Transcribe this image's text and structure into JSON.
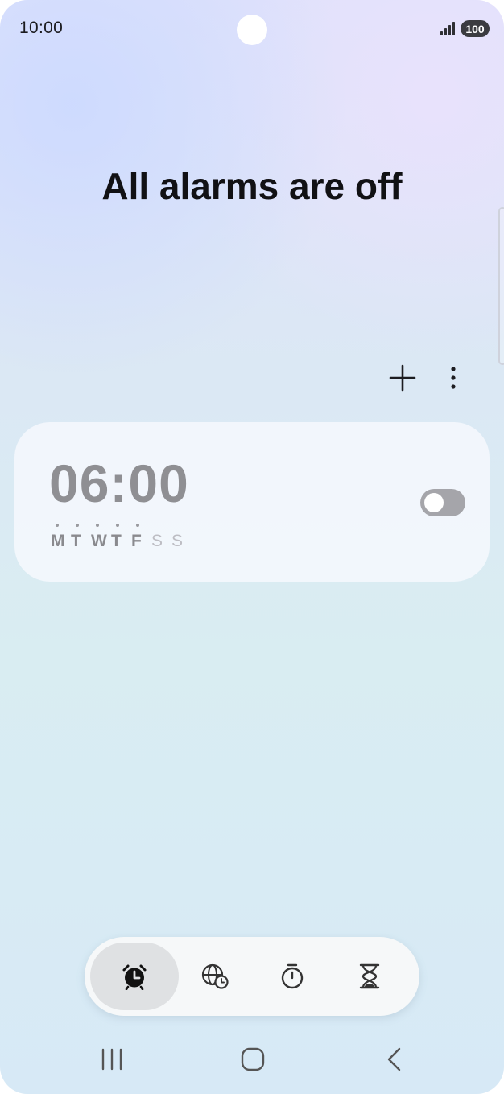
{
  "status_bar": {
    "time": "10:00",
    "battery": "100",
    "icons": [
      "signal-icon",
      "battery-icon"
    ]
  },
  "header": {
    "title": "All alarms are off",
    "add_icon": "plus-icon",
    "more_icon": "more-vertical-icon"
  },
  "alarms": [
    {
      "time": "06:00",
      "days": [
        {
          "label": "M",
          "active": true
        },
        {
          "label": "T",
          "active": true
        },
        {
          "label": "W",
          "active": true
        },
        {
          "label": "T",
          "active": true
        },
        {
          "label": "F",
          "active": true
        },
        {
          "label": "S",
          "active": false
        },
        {
          "label": "S",
          "active": false
        }
      ],
      "enabled": false
    }
  ],
  "tabs": [
    {
      "icon": "alarm-clock-icon",
      "active": true
    },
    {
      "icon": "world-clock-icon",
      "active": false
    },
    {
      "icon": "stopwatch-icon",
      "active": false
    },
    {
      "icon": "hourglass-icon",
      "active": false
    }
  ],
  "nav": {
    "icons": [
      "recent-apps-icon",
      "home-icon",
      "back-icon"
    ]
  },
  "colors": {
    "title": "#111114",
    "alarm_time_inactive": "#8f8f93",
    "toggle_off": "#a5a5aa",
    "active_tab": "#dfe1e3"
  }
}
